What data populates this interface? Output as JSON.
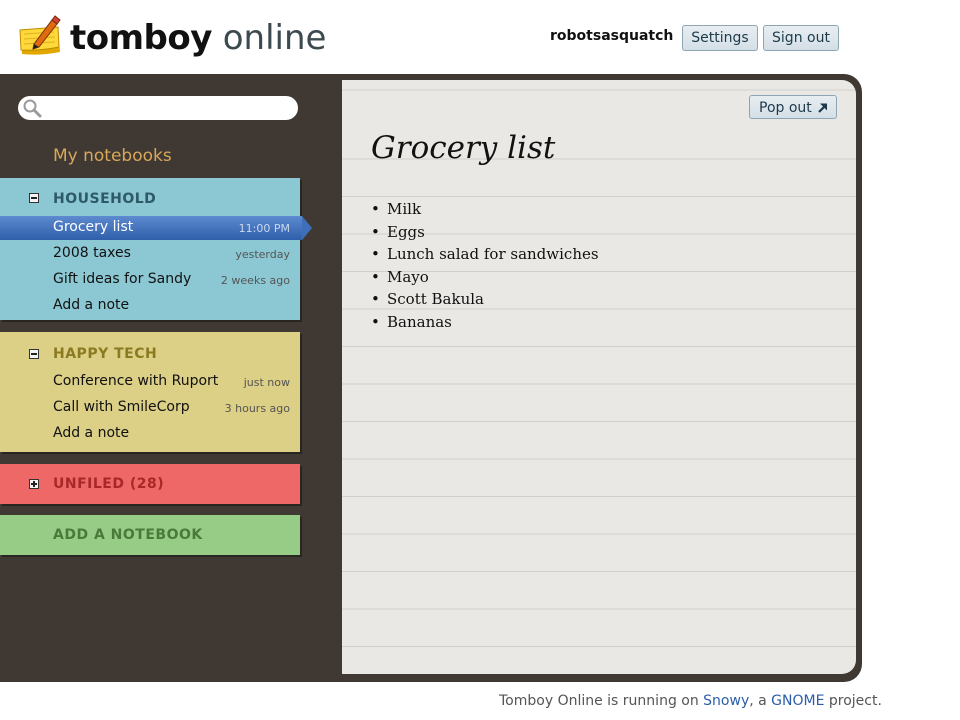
{
  "header": {
    "logo_bold": "tomboy",
    "logo_light": "online",
    "username": "robotsasquatch",
    "settings_label": "Settings",
    "signout_label": "Sign out"
  },
  "sidebar": {
    "search": {
      "value": "",
      "placeholder": ""
    },
    "heading": "My notebooks",
    "notebooks": [
      {
        "name": "HOUSEHOLD",
        "color": "#8cc8d4",
        "expanded": true,
        "notes": [
          {
            "title": "Grocery list",
            "time": "11:00 PM",
            "selected": true
          },
          {
            "title": "2008 taxes",
            "time": "yesterday"
          },
          {
            "title": "Gift ideas for Sandy",
            "time": "2 weeks ago"
          }
        ],
        "add_label": "Add a note"
      },
      {
        "name": "HAPPY TECH",
        "color": "#dccf86",
        "expanded": true,
        "notes": [
          {
            "title": "Conference with Ruport",
            "time": "just now"
          },
          {
            "title": "Call with SmileCorp",
            "time": "3 hours ago"
          }
        ],
        "add_label": "Add a note"
      },
      {
        "name": "UNFILED (28)",
        "color": "#ee6868",
        "expanded": false
      }
    ],
    "add_notebook_label": "ADD A NOTEBOOK"
  },
  "note": {
    "popout_label": "Pop out",
    "title": "Grocery list",
    "items": [
      "Milk",
      "Eggs",
      "Lunch salad for sandwiches",
      "Mayo",
      "Scott Bakula",
      "Bananas"
    ]
  },
  "footer": {
    "prefix": "Tomboy Online is running on ",
    "link1": "Snowy",
    "middle": ", a ",
    "link2": "GNOME",
    "suffix": " project."
  },
  "icons": [
    "notepad-pencil-logo-icon",
    "search-icon",
    "collapse-icon",
    "expand-icon",
    "pop-out-arrow-icon"
  ],
  "colors": {
    "frame": "#403933",
    "heading": "#d8a75a",
    "selected": "#3f6fbb",
    "link": "#2a5ea8"
  }
}
